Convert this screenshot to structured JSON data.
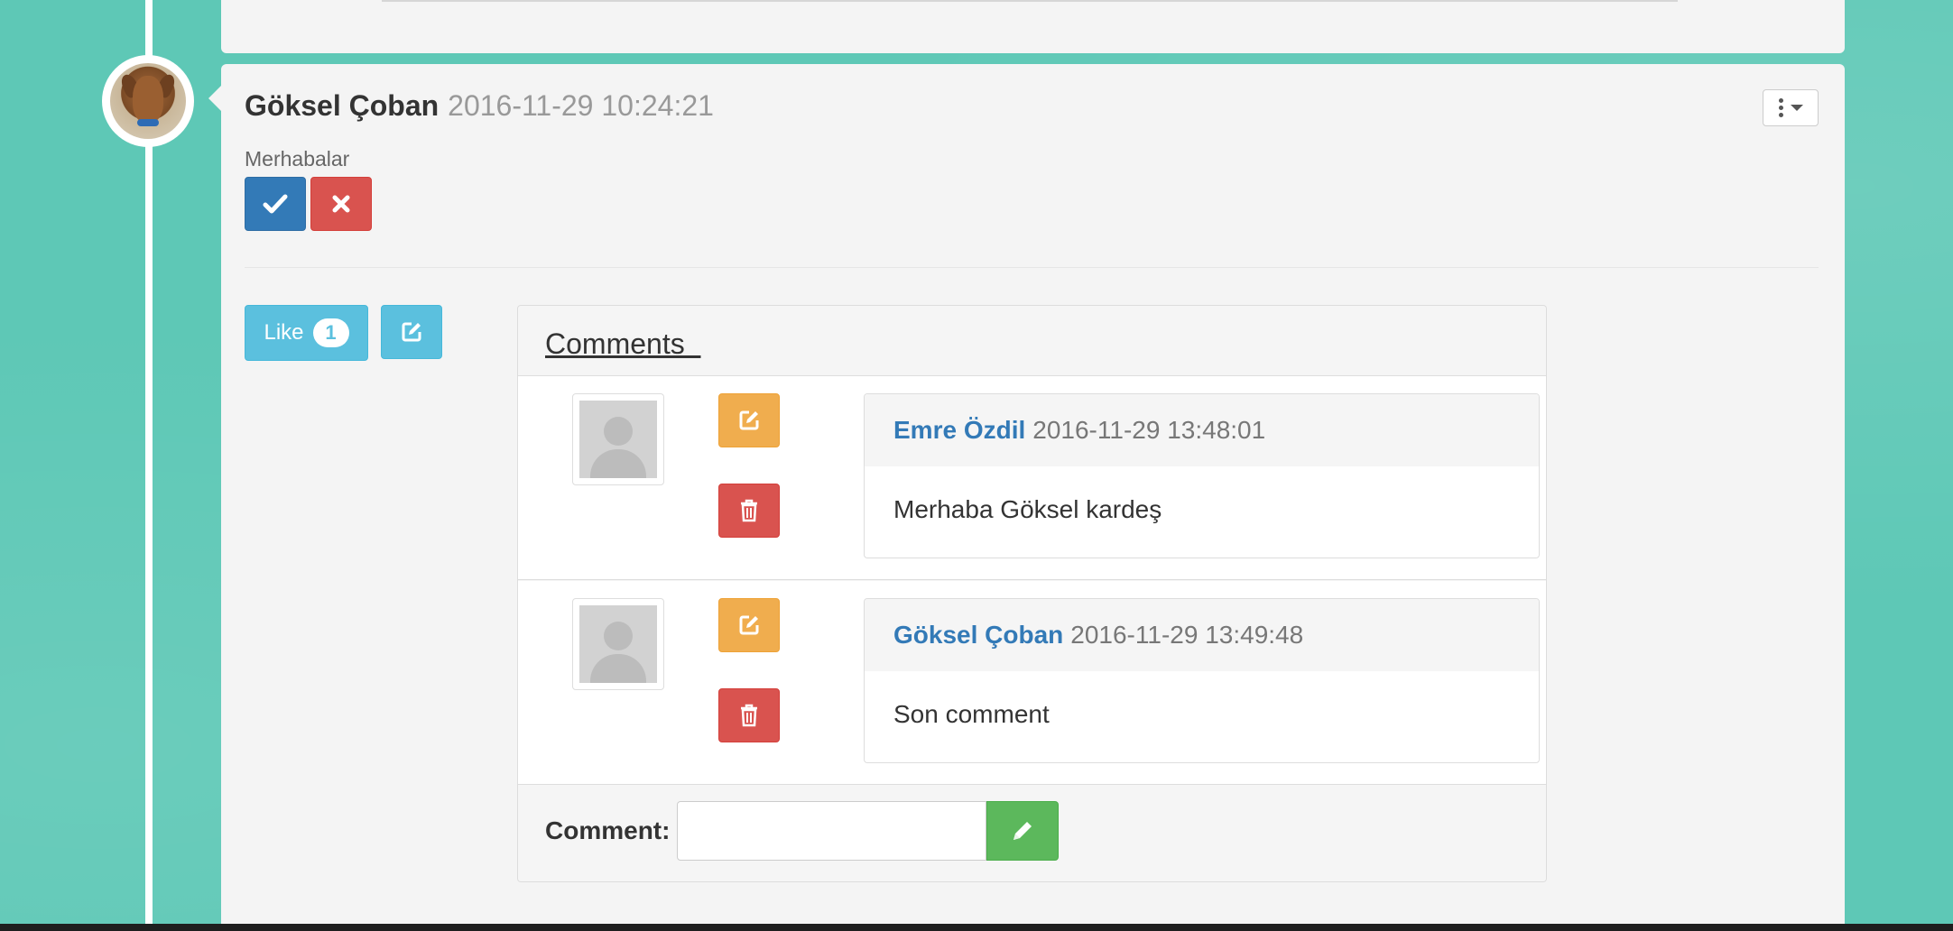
{
  "colors": {
    "background": "#5ec8b6",
    "card": "#f4f4f4",
    "primary": "#337ab7",
    "danger": "#d9534f",
    "info": "#5bc0de",
    "warning": "#f0ad4e",
    "success": "#5cb85c"
  },
  "post": {
    "author": "Göksel Çoban",
    "timestamp": "2016-11-29 10:24:21",
    "body": "Merhabalar",
    "approve_icon": "check-icon",
    "reject_icon": "times-icon",
    "menu_icon": "ellipsis-vertical-icon"
  },
  "actions": {
    "like_label": "Like",
    "like_count": "1",
    "edit_icon": "edit-icon"
  },
  "comments_panel": {
    "title": "Comments  ",
    "comments": [
      {
        "author": "Emre Özdil",
        "timestamp": "2016-11-29 13:48:01",
        "text": "Merhaba Göksel kardeş"
      },
      {
        "author": "Göksel Çoban",
        "timestamp": "2016-11-29 13:49:48",
        "text": "Son comment"
      }
    ],
    "form": {
      "label": "Comment:",
      "input_value": "",
      "submit_icon": "pencil-icon"
    }
  }
}
